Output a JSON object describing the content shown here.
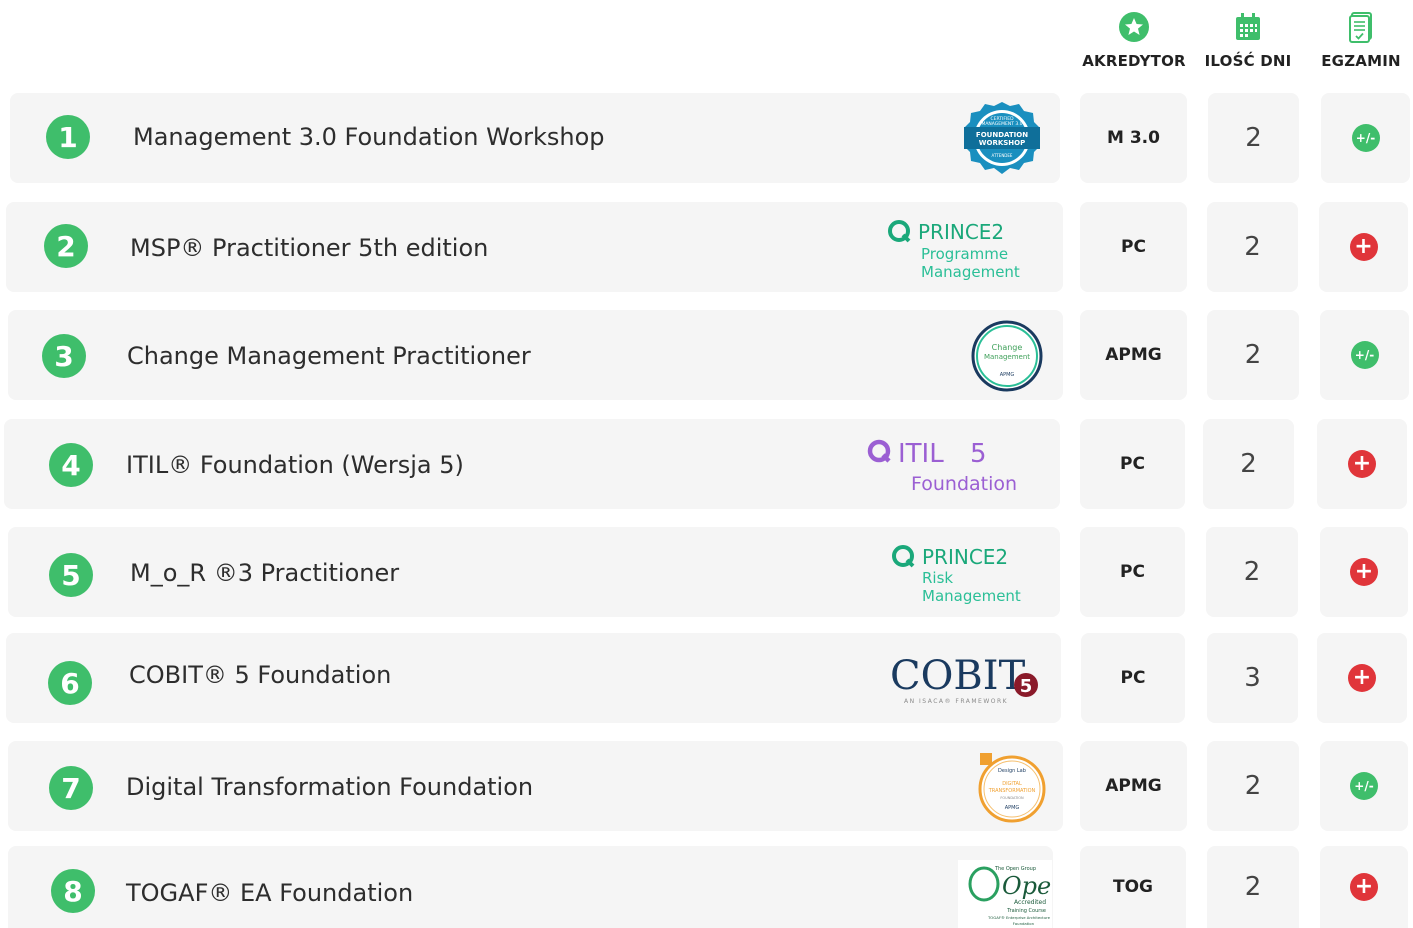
{
  "header": {
    "accreditor_label": "AKREDYTOR",
    "days_label": "ILOŚĆ DNI",
    "exam_label": "EGZAMIN"
  },
  "colors": {
    "accent_green": "#3fbe6b",
    "plus_red": "#e0353a",
    "card_bg": "#f5f5f5"
  },
  "icons": {
    "accreditor": "star-icon",
    "days": "calendar-icon",
    "exam": "exam-document-icon",
    "exam_included": "plus-icon",
    "exam_optional": "plus-minus-icon"
  },
  "courses": [
    {
      "number": "1",
      "title": "Management 3.0 Foundation Workshop",
      "logo": "management-3-0-badge",
      "logo_text": [
        "CERTIFIED",
        "MANAGEMENT 3.0",
        "FOUNDATION",
        "WORKSHOP",
        "ATTENDEE"
      ],
      "accreditor": "M 3.0",
      "days": "2",
      "exam": "+/-"
    },
    {
      "number": "2",
      "title": "MSP® Practitioner 5th edition",
      "logo": "prince2-programme-management-logo",
      "logo_text": [
        "PRINCE2",
        "Programme",
        "Management"
      ],
      "accreditor": "PC",
      "days": "2",
      "exam": "+"
    },
    {
      "number": "3",
      "title": "Change Management Practitioner",
      "logo": "change-management-badge",
      "logo_text": [
        "Change",
        "Management",
        "APMG"
      ],
      "accreditor": "APMG",
      "days": "2",
      "exam": "+/-"
    },
    {
      "number": "4",
      "title": "ITIL® Foundation (Wersja 5)",
      "logo": "itil5-foundation-logo",
      "logo_text": [
        "ITIL",
        "5",
        "Foundation"
      ],
      "accreditor": "PC",
      "days": "2",
      "exam": "+"
    },
    {
      "number": "5",
      "title": "M_o_R ®3 Practitioner",
      "logo": "prince2-risk-management-logo",
      "logo_text": [
        "PRINCE2",
        "Risk",
        "Management"
      ],
      "accreditor": "PC",
      "days": "2",
      "exam": "+"
    },
    {
      "number": "6",
      "title": "COBIT® 5 Foundation",
      "logo": "cobit5-logo",
      "logo_text": [
        "COBIT",
        "5",
        "AN ISACA® FRAMEWORK"
      ],
      "accreditor": "PC",
      "days": "3",
      "exam": "+"
    },
    {
      "number": "7",
      "title": "Digital Transformation Foundation",
      "logo": "digital-transformation-badge",
      "logo_text": [
        "Design Lab",
        "DIGITAL",
        "TRANSFORMATION",
        "FOUNDATION",
        "APMG"
      ],
      "accreditor": "APMG",
      "days": "2",
      "exam": "+/-"
    },
    {
      "number": "8",
      "title": "TOGAF® EA Foundation",
      "logo": "open-group-accredited-logo",
      "logo_text": [
        "The Open Group",
        "Open",
        "Accredited",
        "Training Course",
        "TOGAF® Enterprise Architecture",
        "Foundation"
      ],
      "accreditor": "TOG",
      "days": "2",
      "exam": "+"
    }
  ]
}
